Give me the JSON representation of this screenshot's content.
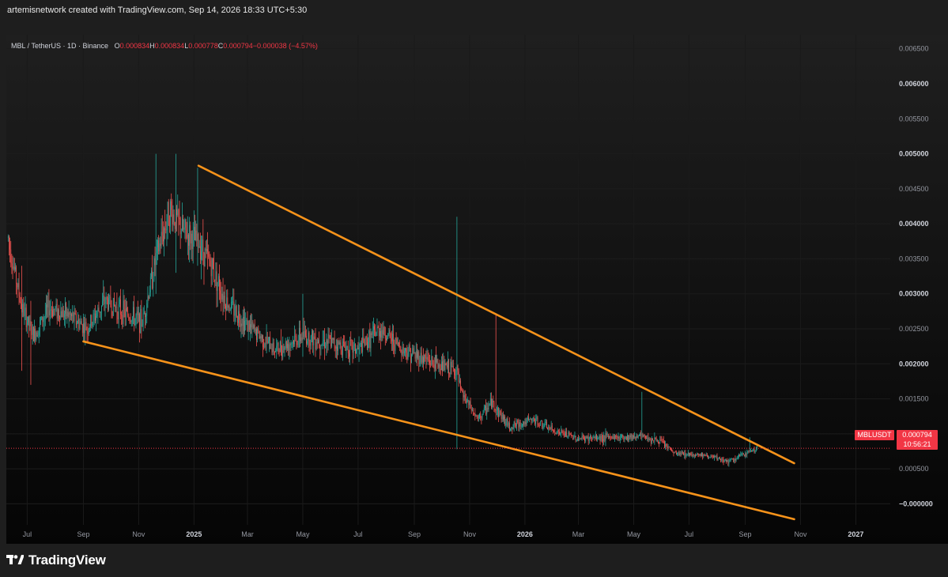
{
  "caption": "artemisnetwork created with TradingView.com, Sep 14, 2026 18:33 UTC+5:30",
  "legend": {
    "symbol": "MBL / TetherUS · 1D · Binance",
    "o_key": "O",
    "o_val": "0.000834",
    "h_key": "H",
    "h_val": "0.000834",
    "l_key": "L",
    "l_val": "0.000778",
    "c_key": "C",
    "c_val": "0.000794",
    "change": "−0.000038 (−4.57%)"
  },
  "price_tag": {
    "symbol": "MBLUSDT",
    "price": "0.000794",
    "countdown": "10:56:21"
  },
  "branding": {
    "name": "TradingView"
  },
  "colors": {
    "background": "#0b0b0b",
    "up": "#26a69a",
    "down": "#ef5350",
    "trendline": "#f7931a",
    "price_line": "#f23645"
  },
  "chart_data": {
    "type": "candlestick",
    "title": "MBL / TetherUS · 1D · Binance",
    "y_axis_ticks": [
      "0.006500",
      "0.006000",
      "0.005500",
      "0.005000",
      "0.004500",
      "0.004000",
      "0.003500",
      "0.003000",
      "0.002500",
      "0.002000",
      "0.001500",
      "0.001000",
      "0.000500",
      "−0.000000"
    ],
    "y_axis_bold": [
      "0.006000",
      "0.005000",
      "0.004000",
      "0.003000",
      "0.002000",
      "0.001000",
      "−0.000000"
    ],
    "ylim": [
      -0.0003,
      0.0067
    ],
    "x_axis_ticks": [
      "Jul",
      "Sep",
      "Nov",
      "2025",
      "Mar",
      "May",
      "Jul",
      "Sep",
      "Nov",
      "2026",
      "Mar",
      "May",
      "Jul",
      "Sep",
      "Nov",
      "2027"
    ],
    "x_axis_bold": [
      "2025",
      "2026",
      "2027"
    ],
    "xlim": [
      "2024-06-08",
      "2027-02-08"
    ],
    "last_close": 0.000794,
    "price_path": [
      [
        "2024-06-10",
        0.0038
      ],
      [
        "2024-06-25",
        0.0028
      ],
      [
        "2024-07-08",
        0.0024
      ],
      [
        "2024-07-25",
        0.0028
      ],
      [
        "2024-08-15",
        0.0027
      ],
      [
        "2024-09-05",
        0.0025
      ],
      [
        "2024-09-25",
        0.0029
      ],
      [
        "2024-10-20",
        0.0027
      ],
      [
        "2024-11-05",
        0.0026
      ],
      [
        "2024-11-20",
        0.0035
      ],
      [
        "2024-12-05",
        0.0042
      ],
      [
        "2024-12-20",
        0.0039
      ],
      [
        "2025-01-08",
        0.0037
      ],
      [
        "2025-01-20",
        0.0034
      ],
      [
        "2025-02-05",
        0.0029
      ],
      [
        "2025-03-05",
        0.0025
      ],
      [
        "2025-04-01",
        0.0022
      ],
      [
        "2025-05-01",
        0.0024
      ],
      [
        "2025-06-01",
        0.0023
      ],
      [
        "2025-07-01",
        0.0022
      ],
      [
        "2025-07-25",
        0.0025
      ],
      [
        "2025-08-20",
        0.0022
      ],
      [
        "2025-09-25",
        0.002
      ],
      [
        "2025-10-18",
        0.0019
      ],
      [
        "2025-10-22",
        0.0016
      ],
      [
        "2025-11-10",
        0.0012
      ],
      [
        "2025-11-25",
        0.00145
      ],
      [
        "2025-12-15",
        0.0011
      ],
      [
        "2026-01-10",
        0.0012
      ],
      [
        "2026-02-01",
        0.00105
      ],
      [
        "2026-03-01",
        0.00093
      ],
      [
        "2026-04-01",
        0.00095
      ],
      [
        "2026-05-10",
        0.00097
      ],
      [
        "2026-06-01",
        0.00088
      ],
      [
        "2026-06-15",
        0.00072
      ],
      [
        "2026-07-15",
        0.0007
      ],
      [
        "2026-08-15",
        0.0006
      ],
      [
        "2026-09-01",
        0.00072
      ],
      [
        "2026-09-14",
        0.000794
      ]
    ],
    "spikes": [
      [
        "2024-06-25",
        0.0034,
        0.0019
      ],
      [
        "2024-07-05",
        0.0029,
        0.0017
      ],
      [
        "2024-11-20",
        0.005,
        0.003
      ],
      [
        "2024-12-12",
        0.005,
        0.0033
      ],
      [
        "2025-01-05",
        0.0048,
        0.0034
      ],
      [
        "2025-05-01",
        0.003,
        0.0021
      ],
      [
        "2025-10-18",
        0.0041,
        0.00078
      ],
      [
        "2025-11-30",
        0.0027,
        0.0012
      ],
      [
        "2026-05-10",
        0.0016,
        0.0009
      ],
      [
        "2026-09-06",
        0.00095,
        0.00075
      ]
    ],
    "trendlines": [
      {
        "from": [
          "2025-01-06",
          0.00483
        ],
        "to": [
          "2026-10-25",
          0.00058
        ]
      },
      {
        "from": [
          "2024-09-01",
          0.00232
        ],
        "to": [
          "2026-10-25",
          -0.00022
        ]
      }
    ]
  }
}
